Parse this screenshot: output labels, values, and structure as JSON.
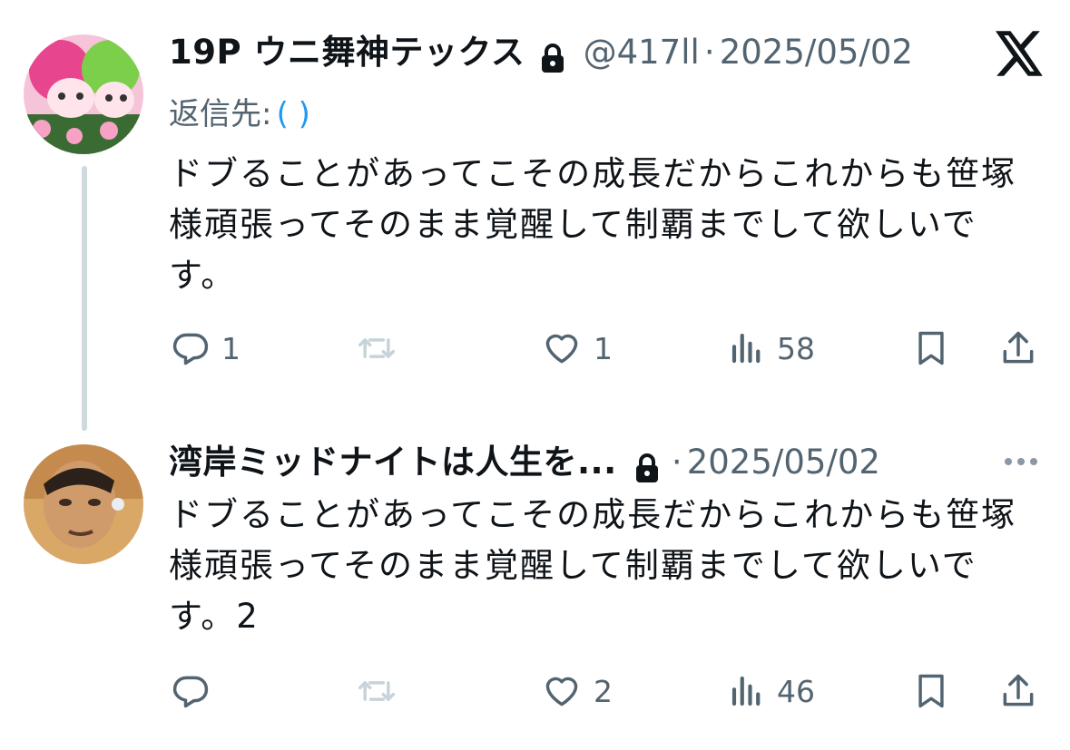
{
  "tweets": [
    {
      "name": "19P ウニ舞神テックス",
      "handle": "@417ll",
      "sep": "·",
      "date": "2025/05/02",
      "reply_to_label": "返信先:",
      "reply_to_handle": "(                              )",
      "text": "ドブることがあってこその成長だからこれからも笹塚様頑張ってそのまま覚醒して制覇までして欲しいです。",
      "actions": {
        "reply": "1",
        "retweet": "",
        "like": "1",
        "views": "58"
      }
    },
    {
      "name": "湾岸ミッドナイトは人生を...",
      "sep": "·",
      "date": "2025/05/02",
      "text": "ドブることがあってこその成長だからこれからも笹塚様頑張ってそのまま覚醒して制覇までして欲しいです。2",
      "actions": {
        "reply": "",
        "retweet": "",
        "like": "2",
        "views": "46"
      }
    }
  ],
  "colors": {
    "text": "#0f1419",
    "muted": "#536471",
    "link": "#1d9bf0",
    "thread": "#cfd9de"
  },
  "icons": [
    "x-logo-icon",
    "lock-icon",
    "more-icon",
    "reply-icon",
    "retweet-icon",
    "like-icon",
    "views-icon",
    "bookmark-icon",
    "share-icon"
  ]
}
